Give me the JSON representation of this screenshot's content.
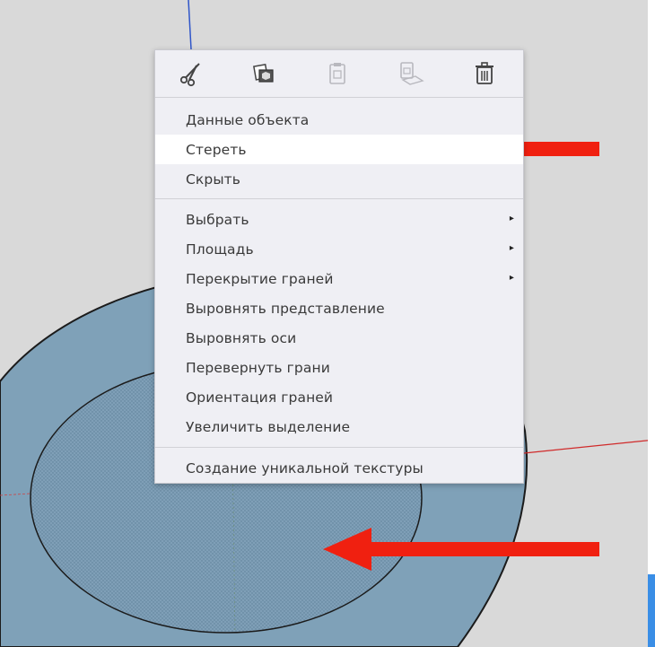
{
  "toolbar": {
    "buttons": [
      {
        "name": "cut",
        "icon": "scissors-icon"
      },
      {
        "name": "copy",
        "icon": "copy-icon"
      },
      {
        "name": "paste",
        "icon": "paste-icon"
      },
      {
        "name": "paste-in-place",
        "icon": "paste-in-place-icon"
      },
      {
        "name": "delete",
        "icon": "trash-icon"
      }
    ]
  },
  "menu": {
    "group1": [
      {
        "label": "Данные объекта"
      },
      {
        "label": "Стереть"
      },
      {
        "label": "Скрыть"
      }
    ],
    "group2": [
      {
        "label": "Выбрать"
      },
      {
        "label": "Площадь"
      },
      {
        "label": "Перекрытие граней"
      },
      {
        "label": "Выровнять представление"
      },
      {
        "label": "Выровнять оси"
      },
      {
        "label": "Перевернуть грани"
      },
      {
        "label": "Ориентация граней"
      },
      {
        "label": "Увеличить выделение"
      }
    ],
    "group3": [
      {
        "label": "Создание уникальной текстуры"
      }
    ],
    "submenu_marker": "▸"
  },
  "colors": {
    "viewport_bg": "#d9d9d9",
    "face_fill": "#7fa1b8",
    "annotation_arrow": "#f02010",
    "menu_bg": "#efeff4",
    "highlight_bg": "#ffffff",
    "text": "#3a3a3a"
  }
}
